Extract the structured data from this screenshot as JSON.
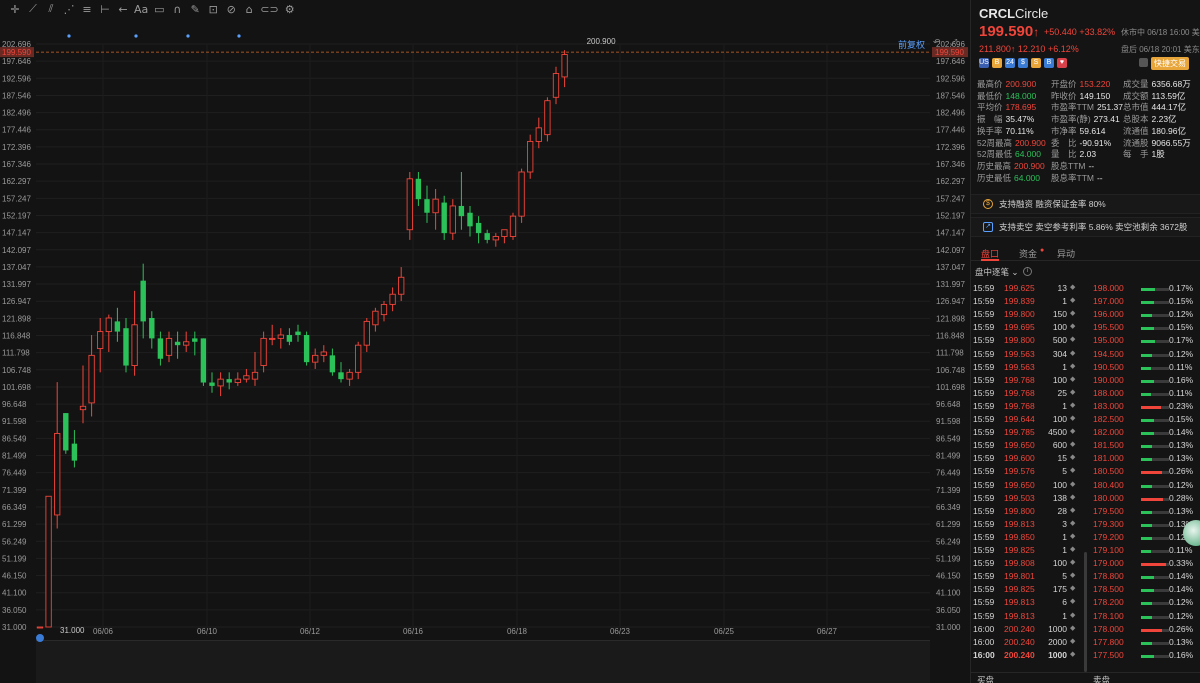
{
  "toolbar": {
    "icons": [
      "crosshair-icon",
      "line-tool-icon",
      "channel-tool-icon",
      "multi-line-icon",
      "fib-icon",
      "measure-icon",
      "arrow-icon",
      "text-icon",
      "comment-icon",
      "magnet-icon",
      "lock-icon",
      "eye-icon",
      "trash-icon",
      "link-icon",
      "settings-icon"
    ],
    "text_label": "Aa"
  },
  "chart": {
    "fuquan_label": "前复权",
    "y_axis_ticks": [
      "202.696",
      "197.646",
      "192.596",
      "187.546",
      "182.496",
      "177.446",
      "172.396",
      "167.346",
      "162.297",
      "157.247",
      "152.197",
      "147.147",
      "142.097",
      "137.047",
      "131.997",
      "126.947",
      "121.898",
      "116.848",
      "111.798",
      "106.748",
      "101.698",
      "96.648",
      "91.598",
      "86.549",
      "81.499",
      "76.449",
      "71.399",
      "66.349",
      "61.299",
      "56.249",
      "51.199",
      "46.150",
      "41.100",
      "36.050",
      "31.000"
    ],
    "x_axis_labels": [
      "06/06",
      "06/10",
      "06/12",
      "06/16",
      "06/18",
      "06/23",
      "06/25",
      "06/27"
    ],
    "high_label": "200.900",
    "low_label": "31.000",
    "current_price_tag": "199.590",
    "up_color": "#f0453a",
    "down_color": "#2bc25a",
    "candles": [
      {
        "o": 31,
        "h": 31,
        "l": 31,
        "c": 31
      },
      {
        "o": 31,
        "h": 69.5,
        "l": 31,
        "c": 69.5
      },
      {
        "o": 64,
        "h": 103.1,
        "l": 60,
        "c": 88
      },
      {
        "o": 94,
        "h": 94,
        "l": 82,
        "c": 83
      },
      {
        "o": 85,
        "h": 89,
        "l": 78,
        "c": 80
      },
      {
        "o": 95,
        "h": 108,
        "l": 91,
        "c": 96
      },
      {
        "o": 97,
        "h": 117,
        "l": 93,
        "c": 111
      },
      {
        "o": 113,
        "h": 122,
        "l": 106,
        "c": 118
      },
      {
        "o": 118,
        "h": 123,
        "l": 112,
        "c": 122
      },
      {
        "o": 121,
        "h": 125,
        "l": 115,
        "c": 118
      },
      {
        "o": 119,
        "h": 122,
        "l": 106,
        "c": 108
      },
      {
        "o": 108,
        "h": 130,
        "l": 105,
        "c": 120
      },
      {
        "o": 133,
        "h": 138,
        "l": 116,
        "c": 121
      },
      {
        "o": 122,
        "h": 124,
        "l": 113,
        "c": 116
      },
      {
        "o": 116,
        "h": 118,
        "l": 108,
        "c": 110
      },
      {
        "o": 111,
        "h": 118,
        "l": 109,
        "c": 116
      },
      {
        "o": 115,
        "h": 118,
        "l": 110,
        "c": 114
      },
      {
        "o": 114,
        "h": 118,
        "l": 112,
        "c": 115
      },
      {
        "o": 116,
        "h": 118,
        "l": 111,
        "c": 115
      },
      {
        "o": 116,
        "h": 116,
        "l": 102,
        "c": 103
      },
      {
        "o": 103,
        "h": 106,
        "l": 100,
        "c": 102
      },
      {
        "o": 102,
        "h": 106,
        "l": 99,
        "c": 104
      },
      {
        "o": 104,
        "h": 106,
        "l": 101,
        "c": 103
      },
      {
        "o": 103,
        "h": 106,
        "l": 102,
        "c": 104
      },
      {
        "o": 104,
        "h": 107,
        "l": 103,
        "c": 105
      },
      {
        "o": 104,
        "h": 112,
        "l": 102,
        "c": 106
      },
      {
        "o": 108,
        "h": 118,
        "l": 106,
        "c": 116
      },
      {
        "o": 116,
        "h": 120,
        "l": 114,
        "c": 116
      },
      {
        "o": 116,
        "h": 119,
        "l": 113,
        "c": 117
      },
      {
        "o": 117,
        "h": 119,
        "l": 114,
        "c": 115
      },
      {
        "o": 118,
        "h": 120,
        "l": 115,
        "c": 117
      },
      {
        "o": 117,
        "h": 118,
        "l": 108,
        "c": 109
      },
      {
        "o": 109,
        "h": 113,
        "l": 107,
        "c": 111
      },
      {
        "o": 111,
        "h": 114,
        "l": 109,
        "c": 112
      },
      {
        "o": 111,
        "h": 113,
        "l": 105,
        "c": 106
      },
      {
        "o": 106,
        "h": 109,
        "l": 103,
        "c": 104
      },
      {
        "o": 104,
        "h": 107,
        "l": 102,
        "c": 106
      },
      {
        "o": 106,
        "h": 115,
        "l": 104,
        "c": 114
      },
      {
        "o": 114,
        "h": 122,
        "l": 112,
        "c": 121
      },
      {
        "o": 120,
        "h": 125,
        "l": 118,
        "c": 124
      },
      {
        "o": 123,
        "h": 127,
        "l": 121,
        "c": 126
      },
      {
        "o": 126,
        "h": 131,
        "l": 124,
        "c": 129
      },
      {
        "o": 129,
        "h": 137,
        "l": 127,
        "c": 134
      },
      {
        "o": 148,
        "h": 165,
        "l": 145,
        "c": 163
      },
      {
        "o": 163,
        "h": 165,
        "l": 155,
        "c": 157
      },
      {
        "o": 157,
        "h": 161,
        "l": 150,
        "c": 153
      },
      {
        "o": 153,
        "h": 160,
        "l": 148,
        "c": 157
      },
      {
        "o": 156,
        "h": 158,
        "l": 145,
        "c": 147
      },
      {
        "o": 147,
        "h": 157,
        "l": 145,
        "c": 155
      },
      {
        "o": 155,
        "h": 165,
        "l": 148,
        "c": 152
      },
      {
        "o": 153,
        "h": 155,
        "l": 146,
        "c": 149
      },
      {
        "o": 150,
        "h": 152,
        "l": 144,
        "c": 147
      },
      {
        "o": 147,
        "h": 148,
        "l": 144,
        "c": 145
      },
      {
        "o": 145,
        "h": 147,
        "l": 143,
        "c": 146
      },
      {
        "o": 146,
        "h": 148,
        "l": 144,
        "c": 148
      },
      {
        "o": 146,
        "h": 153,
        "l": 145,
        "c": 152
      },
      {
        "o": 152,
        "h": 166,
        "l": 150,
        "c": 165
      },
      {
        "o": 165,
        "h": 176,
        "l": 163,
        "c": 174
      },
      {
        "o": 174,
        "h": 181,
        "l": 172,
        "c": 178
      },
      {
        "o": 176,
        "h": 187,
        "l": 174,
        "c": 186
      },
      {
        "o": 187,
        "h": 196,
        "l": 185,
        "c": 194
      },
      {
        "o": 193,
        "h": 200.9,
        "l": 190,
        "c": 199.59
      }
    ]
  },
  "quote": {
    "symbol": "CRCL",
    "name": "Circle",
    "price": "199.590",
    "arrow": "↑",
    "change": "+50.440",
    "change_pct": "+33.82%",
    "status": "休市中 06/18 16:00 美东",
    "after_price": "211.800",
    "after_change": "12.210",
    "after_change_pct": "+6.12%",
    "after_status": "盘后 06/18 20:01 美东",
    "quick_trade": "快捷交易",
    "badges": [
      "US",
      "B",
      "24",
      "$",
      "S",
      "B",
      "♥"
    ]
  },
  "stats": [
    {
      "label": "最高价",
      "value": "200.900",
      "color": "red",
      "col": 0
    },
    {
      "label": "开盘价",
      "value": "153.220",
      "color": "red",
      "col": 1
    },
    {
      "label": "成交量",
      "value": "6356.68万",
      "color": "",
      "col": 2
    },
    {
      "label": "最低价",
      "value": "148.000",
      "color": "green",
      "col": 0
    },
    {
      "label": "昨收价",
      "value": "149.150",
      "color": "",
      "col": 1
    },
    {
      "label": "成交额",
      "value": "113.59亿",
      "color": "",
      "col": 2
    },
    {
      "label": "平均价",
      "value": "178.695",
      "color": "red",
      "col": 0
    },
    {
      "label": "市盈率TTM",
      "value": "251.37",
      "color": "",
      "col": 1
    },
    {
      "label": "总市值",
      "value": "444.17亿",
      "color": "",
      "col": 2
    },
    {
      "label": "振　幅",
      "value": "35.47%",
      "color": "",
      "col": 0
    },
    {
      "label": "市盈率(静)",
      "value": "273.41",
      "color": "",
      "col": 1
    },
    {
      "label": "总股本",
      "value": "2.23亿",
      "color": "",
      "col": 2
    },
    {
      "label": "换手率",
      "value": "70.11%",
      "color": "",
      "col": 0
    },
    {
      "label": "市净率",
      "value": "59.614",
      "color": "",
      "col": 1
    },
    {
      "label": "流通值",
      "value": "180.96亿",
      "color": "",
      "col": 2
    },
    {
      "label": "52周最高",
      "value": "200.900",
      "color": "red",
      "col": 0
    },
    {
      "label": "委　比",
      "value": "-90.91%",
      "color": "",
      "col": 1
    },
    {
      "label": "流通股",
      "value": "9066.55万",
      "color": "",
      "col": 2
    },
    {
      "label": "52周最低",
      "value": "64.000",
      "color": "green",
      "col": 0
    },
    {
      "label": "量　比",
      "value": "2.03",
      "color": "",
      "col": 1
    },
    {
      "label": "每　手",
      "value": "1股",
      "color": "",
      "col": 2
    },
    {
      "label": "历史最高",
      "value": "200.900",
      "color": "red",
      "col": 0
    },
    {
      "label": "股息TTM",
      "value": "--",
      "color": "",
      "col": 1
    },
    {
      "label": "历史最低",
      "value": "64.000",
      "color": "green",
      "col": 0
    },
    {
      "label": "股息率TTM",
      "value": "--",
      "color": "",
      "col": 1
    }
  ],
  "notes": {
    "margin": "支持融资 融资保证金率 80%",
    "short": "支持卖空 卖空参考利率 5.86% 卖空池剩余 3672股"
  },
  "tabs": [
    "盘口",
    "资金",
    "异动"
  ],
  "ticks_header": "盘中逐笔",
  "ticks": [
    {
      "t": "15:59",
      "p": "199.625",
      "v": "13",
      "lv": "198.000",
      "pct": "0.17%",
      "w": 0.5,
      "c": "#2bc25a"
    },
    {
      "t": "15:59",
      "p": "199.839",
      "v": "1",
      "lv": "197.000",
      "pct": "0.15%",
      "w": 0.45,
      "c": "#2bc25a"
    },
    {
      "t": "15:59",
      "p": "199.800",
      "v": "150",
      "lv": "196.000",
      "pct": "0.12%",
      "w": 0.4,
      "c": "#2bc25a"
    },
    {
      "t": "15:59",
      "p": "199.695",
      "v": "100",
      "lv": "195.500",
      "pct": "0.15%",
      "w": 0.45,
      "c": "#2bc25a"
    },
    {
      "t": "15:59",
      "p": "199.800",
      "v": "500",
      "lv": "195.000",
      "pct": "0.17%",
      "w": 0.5,
      "c": "#2bc25a"
    },
    {
      "t": "15:59",
      "p": "199.563",
      "v": "304",
      "lv": "194.500",
      "pct": "0.12%",
      "w": 0.4,
      "c": "#2bc25a"
    },
    {
      "t": "15:59",
      "p": "199.563",
      "v": "1",
      "lv": "190.500",
      "pct": "0.11%",
      "w": 0.35,
      "c": "#2bc25a"
    },
    {
      "t": "15:59",
      "p": "199.768",
      "v": "100",
      "lv": "190.000",
      "pct": "0.16%",
      "w": 0.45,
      "c": "#2bc25a"
    },
    {
      "t": "15:59",
      "p": "199.768",
      "v": "25",
      "lv": "188.000",
      "pct": "0.11%",
      "w": 0.35,
      "c": "#2bc25a"
    },
    {
      "t": "15:59",
      "p": "199.768",
      "v": "1",
      "lv": "183.000",
      "pct": "0.23%",
      "w": 0.7,
      "c": "#f0453a"
    },
    {
      "t": "15:59",
      "p": "199.644",
      "v": "100",
      "lv": "182.500",
      "pct": "0.15%",
      "w": 0.45,
      "c": "#2bc25a"
    },
    {
      "t": "15:59",
      "p": "199.785",
      "v": "4500",
      "lv": "182.000",
      "pct": "0.14%",
      "w": 0.45,
      "c": "#2bc25a"
    },
    {
      "t": "15:59",
      "p": "199.650",
      "v": "600",
      "lv": "181.500",
      "pct": "0.13%",
      "w": 0.4,
      "c": "#2bc25a"
    },
    {
      "t": "15:59",
      "p": "199.600",
      "v": "15",
      "lv": "181.000",
      "pct": "0.13%",
      "w": 0.4,
      "c": "#2bc25a"
    },
    {
      "t": "15:59",
      "p": "199.576",
      "v": "5",
      "lv": "180.500",
      "pct": "0.26%",
      "w": 0.75,
      "c": "#f0453a"
    },
    {
      "t": "15:59",
      "p": "199.650",
      "v": "100",
      "lv": "180.400",
      "pct": "0.12%",
      "w": 0.4,
      "c": "#2bc25a"
    },
    {
      "t": "15:59",
      "p": "199.503",
      "v": "138",
      "lv": "180.000",
      "pct": "0.28%",
      "w": 0.8,
      "c": "#f0453a"
    },
    {
      "t": "15:59",
      "p": "199.800",
      "v": "28",
      "lv": "179.500",
      "pct": "0.13%",
      "w": 0.4,
      "c": "#2bc25a"
    },
    {
      "t": "15:59",
      "p": "199.813",
      "v": "3",
      "lv": "179.300",
      "pct": "0.13%",
      "w": 0.4,
      "c": "#2bc25a"
    },
    {
      "t": "15:59",
      "p": "199.850",
      "v": "1",
      "lv": "179.200",
      "pct": "0.12%",
      "w": 0.4,
      "c": "#2bc25a"
    },
    {
      "t": "15:59",
      "p": "199.825",
      "v": "1",
      "lv": "179.100",
      "pct": "0.11%",
      "w": 0.35,
      "c": "#2bc25a"
    },
    {
      "t": "15:59",
      "p": "199.808",
      "v": "100",
      "lv": "179.000",
      "pct": "0.33%",
      "w": 0.9,
      "c": "#f0453a"
    },
    {
      "t": "15:59",
      "p": "199.801",
      "v": "5",
      "lv": "178.800",
      "pct": "0.14%",
      "w": 0.45,
      "c": "#2bc25a"
    },
    {
      "t": "15:59",
      "p": "199.825",
      "v": "175",
      "lv": "178.500",
      "pct": "0.14%",
      "w": 0.45,
      "c": "#2bc25a"
    },
    {
      "t": "15:59",
      "p": "199.813",
      "v": "6",
      "lv": "178.200",
      "pct": "0.12%",
      "w": 0.4,
      "c": "#2bc25a"
    },
    {
      "t": "15:59",
      "p": "199.813",
      "v": "1",
      "lv": "178.100",
      "pct": "0.12%",
      "w": 0.4,
      "c": "#2bc25a"
    },
    {
      "t": "16:00",
      "p": "200.240",
      "v": "1000",
      "lv": "178.000",
      "pct": "0.26%",
      "w": 0.75,
      "c": "#f0453a"
    },
    {
      "t": "16:00",
      "p": "200.240",
      "v": "2000",
      "lv": "177.800",
      "pct": "0.13%",
      "w": 0.4,
      "c": "#2bc25a"
    },
    {
      "t": "16:00",
      "p": "200.240",
      "v": "1000",
      "lv": "177.500",
      "pct": "0.16%",
      "w": 0.45,
      "c": "#2bc25a",
      "bold": true
    }
  ],
  "footer": {
    "buy": "买盘",
    "sell": "卖盘"
  }
}
